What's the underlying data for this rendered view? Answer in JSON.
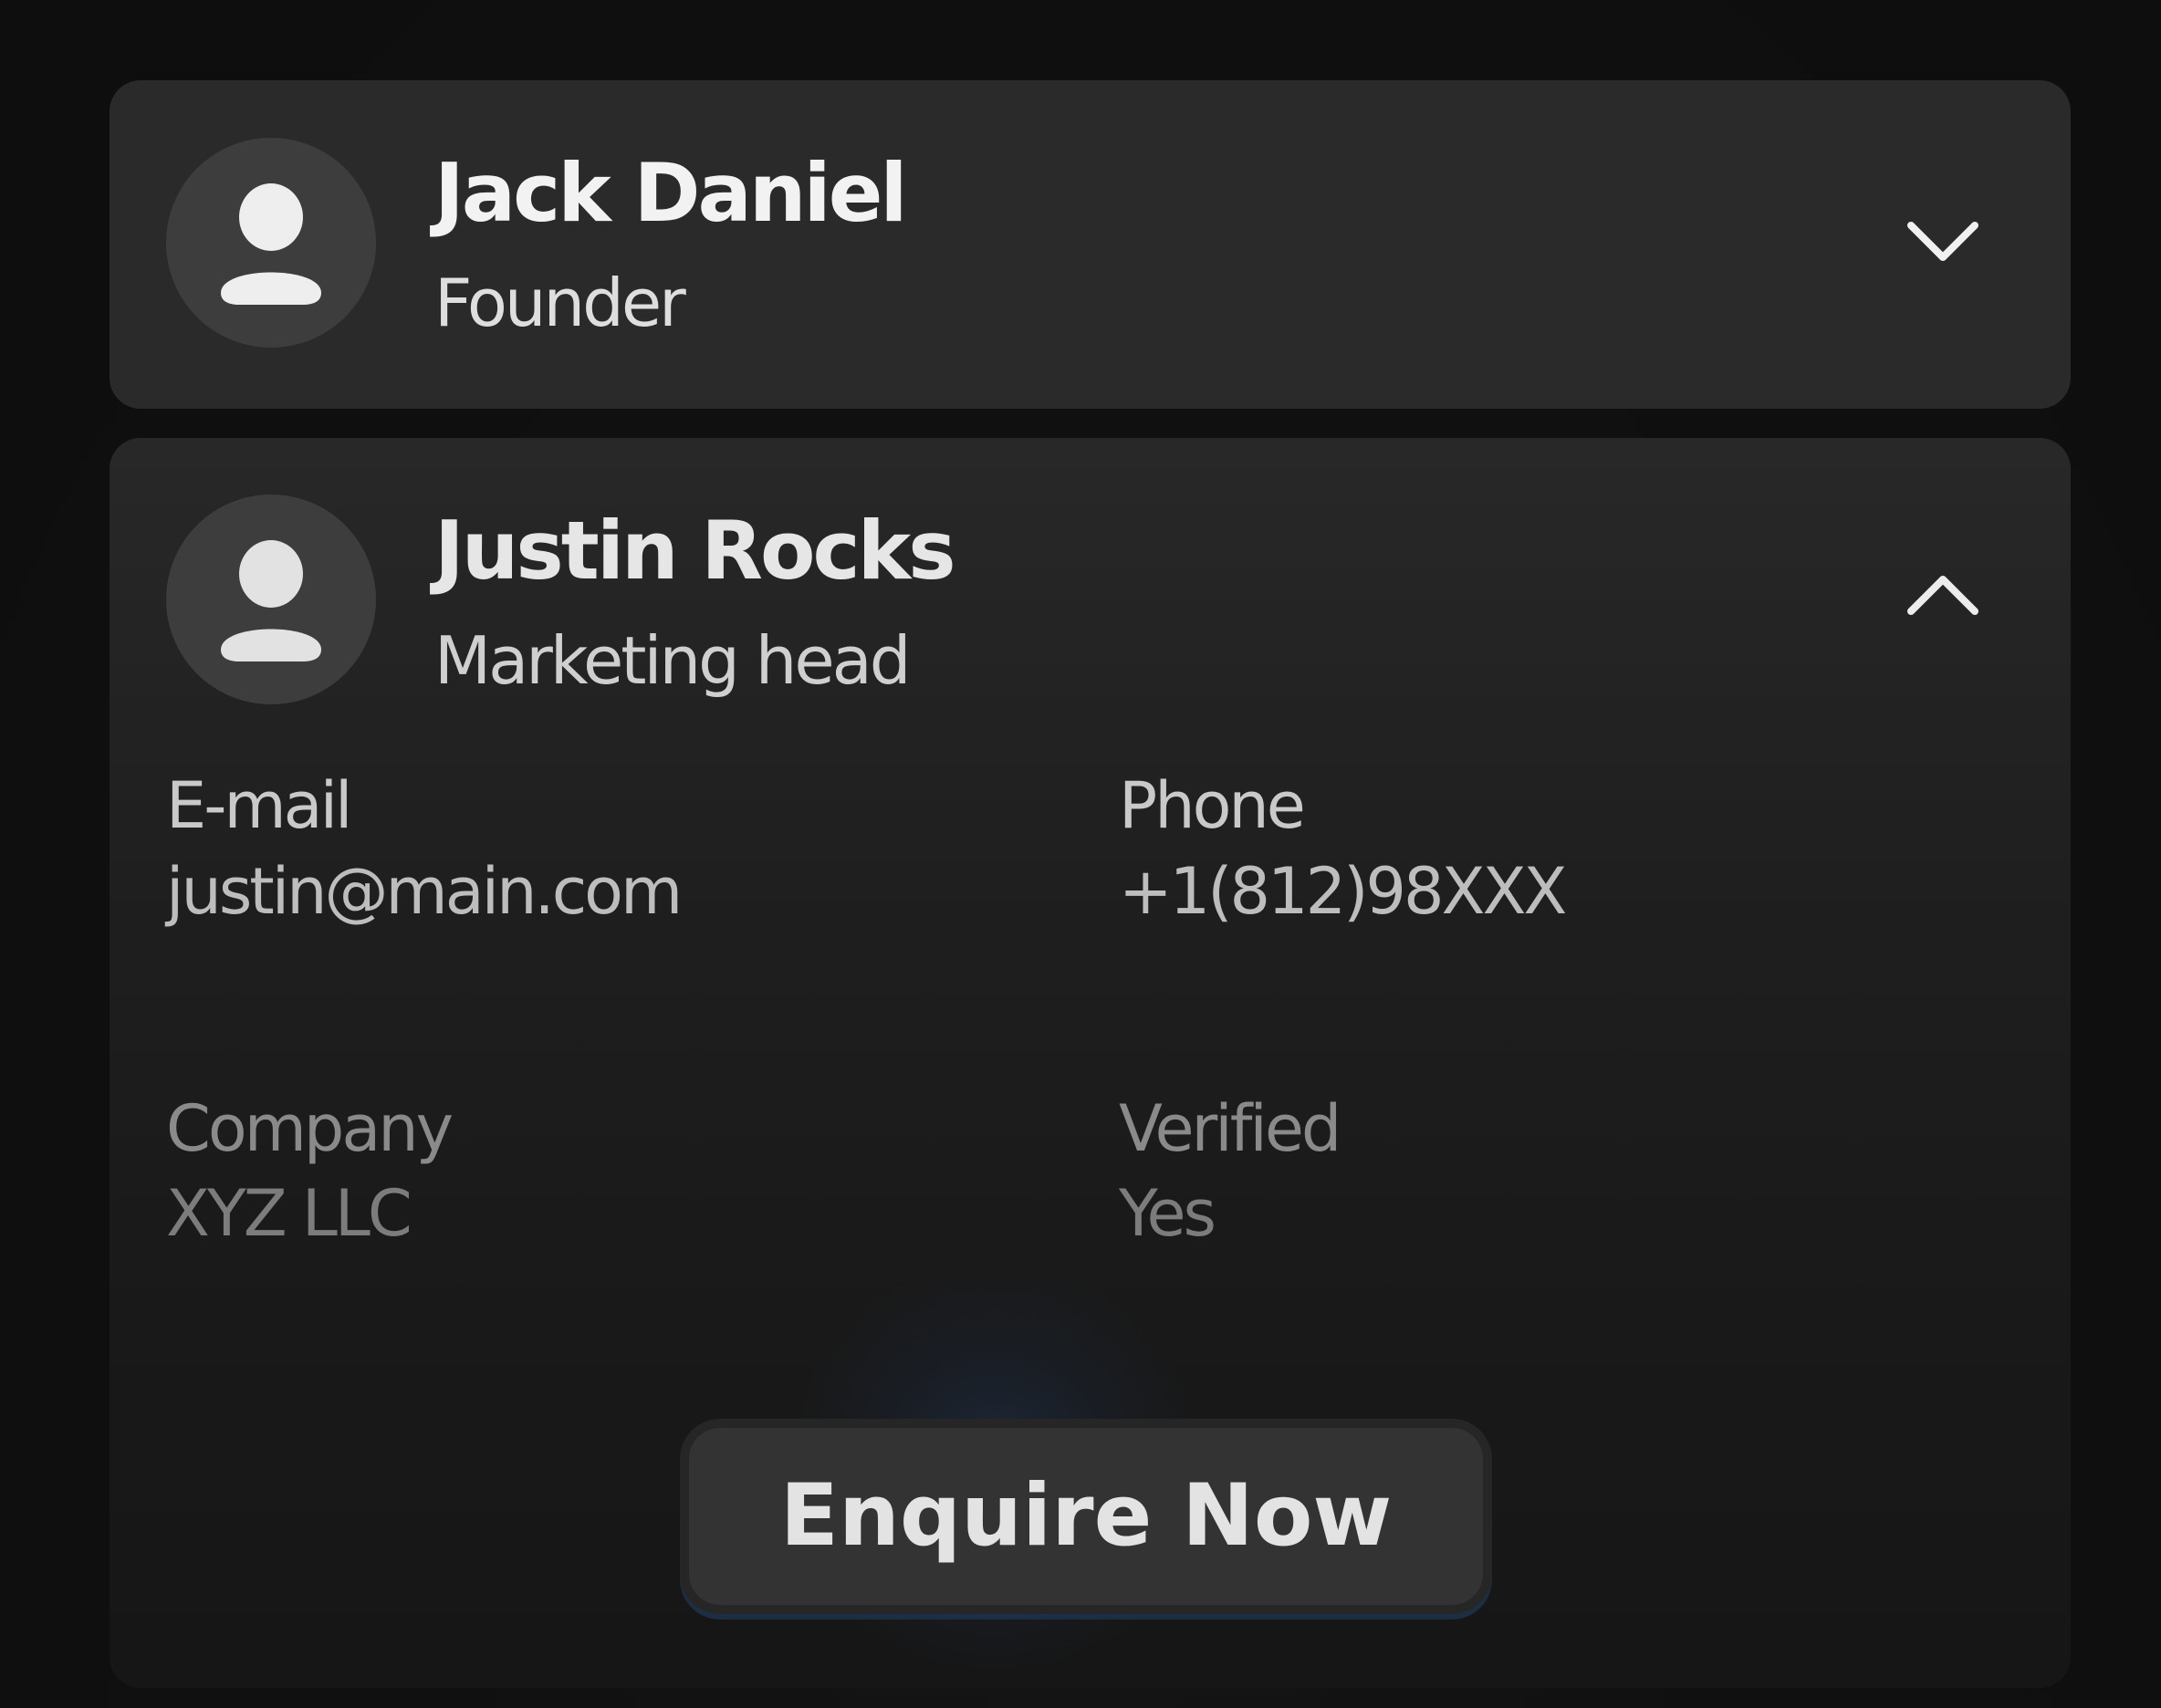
{
  "contacts": [
    {
      "name": "Jack Daniel",
      "role": "Founder",
      "expanded": false,
      "chevron_icon": "chevron-down-icon"
    },
    {
      "name": "Justin Rocks",
      "role": "Marketing head",
      "expanded": true,
      "chevron_icon": "chevron-up-icon",
      "details": {
        "email_label": "E-mail",
        "email_value": "justin@main.com",
        "phone_label": "Phone",
        "phone_value": "+1(812)98XXX",
        "company_label": "Company",
        "company_value": "XYZ LLC",
        "verified_label": "Verified",
        "verified_value": "Yes"
      }
    }
  ],
  "cta": {
    "label": "Enquire Now"
  },
  "colors": {
    "background": "#0f0f0f",
    "card": "#2a2a2a",
    "avatar": "#3d3d3d",
    "text_primary": "#f2f2f2",
    "button": "#333333"
  }
}
